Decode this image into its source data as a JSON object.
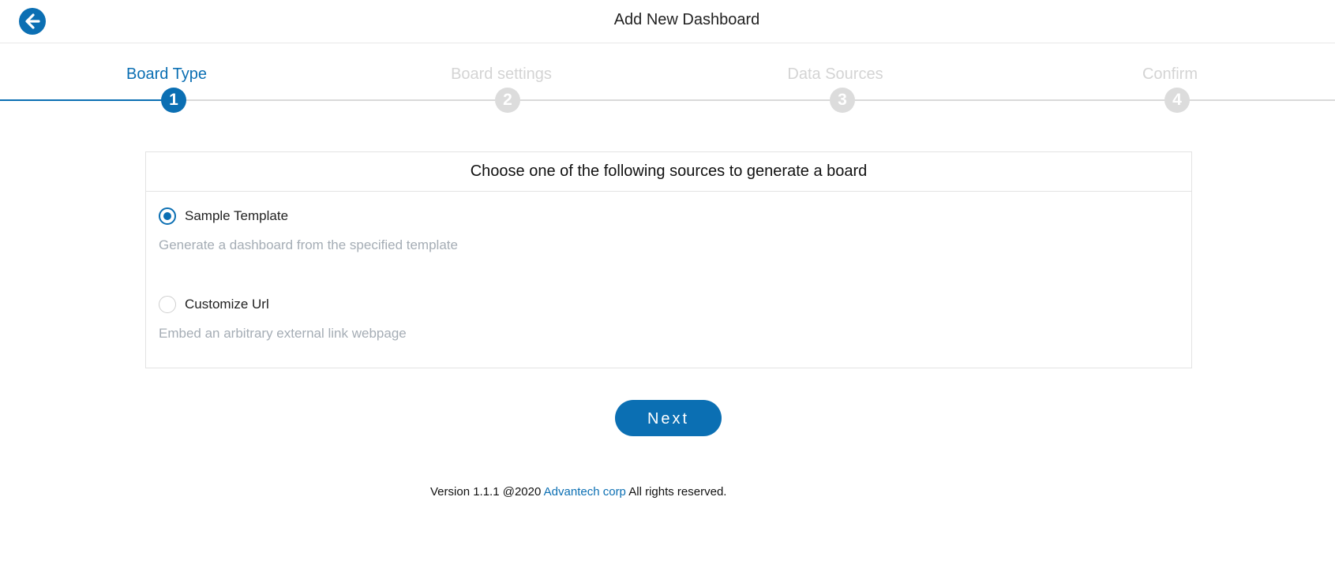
{
  "header": {
    "title": "Add New Dashboard",
    "back_icon": "arrow-left-icon"
  },
  "stepper": {
    "steps": [
      {
        "label": "Board Type",
        "number": "1",
        "state": "active"
      },
      {
        "label": "Board settings",
        "number": "2",
        "state": "inactive"
      },
      {
        "label": "Data Sources",
        "number": "3",
        "state": "inactive"
      },
      {
        "label": "Confirm",
        "number": "4",
        "state": "inactive"
      }
    ]
  },
  "card": {
    "title": "Choose one of the following sources to generate a board",
    "options": [
      {
        "label": "Sample Template",
        "description": "Generate a dashboard from the specified template",
        "selected": true
      },
      {
        "label": "Customize Url",
        "description": "Embed an arbitrary external link webpage",
        "selected": false
      }
    ]
  },
  "actions": {
    "next_label": "Next"
  },
  "footer": {
    "prefix": "Version 1.1.1 @2020",
    "link": "Advantech corp",
    "suffix": "All rights reserved."
  },
  "colors": {
    "accent": "#0b6fb3",
    "inactive_step": "#d4d4d4",
    "muted_text": "#a5adb5"
  }
}
